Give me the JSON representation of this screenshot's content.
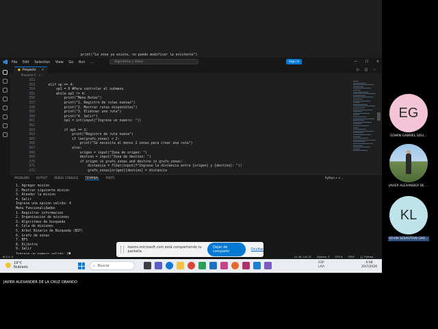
{
  "top_code": {
    "line": "print(\"La zona ya existe, no puedo modificar la existente\")"
  },
  "vscode": {
    "menu": [
      "File",
      "Edit",
      "Selection",
      "View",
      "Go",
      "Run",
      "..."
    ],
    "search_placeholder": "Algoritmos y datos",
    "sign_in": "Sign In",
    "explorer_title": "Proyecto",
    "explorer_folder": "Proyecto Y...",
    "active_tab": "Proyecto",
    "breadcrumb": "Proyecto Y... > ...",
    "code_lines": [
      {
        "n": "352",
        "t": ""
      },
      {
        "n": "353",
        "t": "    elif op == 4:"
      },
      {
        "n": "354",
        "t": "        op1 = 0 #Para controlar el submenu"
      },
      {
        "n": "355",
        "t": "        while op1 != 4:"
      },
      {
        "n": "356",
        "t": "            print(\"Menu Rutas\")"
      },
      {
        "n": "357",
        "t": "            print(\"1. Registro de rutas nuevas\")"
      },
      {
        "n": "358",
        "t": "            print(\"2. Mostrar rutas disponibles\")"
      },
      {
        "n": "359",
        "t": "            print(\"3. Eliminar una ruta\")"
      },
      {
        "n": "360",
        "t": "            print(\"4. Salir\")"
      },
      {
        "n": "361",
        "t": "            op1 = int(input(\"Ingrese un numero: \"))"
      },
      {
        "n": "362",
        "t": ""
      },
      {
        "n": "363",
        "t": "            if op1 == 1:"
      },
      {
        "n": "364",
        "t": "                print(\"Registro de ruta nueva\")"
      },
      {
        "n": "365",
        "t": "                if len(grafo_zonas) < 2:"
      },
      {
        "n": "366",
        "t": "                    print(\"Se necesita al menos 2 zonas para crear una ruta\")"
      },
      {
        "n": "367",
        "t": "                else:"
      },
      {
        "n": "368",
        "t": "                    origen = input(\"Zona de origen: \")"
      },
      {
        "n": "369",
        "t": "                    destino = input(\"Zona de destino: \")"
      },
      {
        "n": "370",
        "t": "                    if origen in grafo_zonas and destino in grafo_zonas:"
      },
      {
        "n": "371",
        "t": "                        distancia = float(input(f\"Ingrese la distancia entre {origen} y {destino}: \"))"
      },
      {
        "n": "372",
        "t": "                        grafo_zonas[origen][destino] = distancia"
      }
    ],
    "panel_tabs": [
      "PROBLEMS",
      "OUTPUT",
      "DEBUG CONSOLE",
      "TERMINAL",
      "PORTS"
    ],
    "panel_tools": "Python + v  ...",
    "terminal_lines": [
      "1. Agregar mision",
      "2. Mostrar siguiente mision",
      "3. Atender la mision",
      "4. Salir",
      "Ingrese una opcion valida: 4",
      "Menu Funcionalidades",
      "1. Registrar informacion",
      "2. Organizacion de misiones",
      "3. Algoritmos de busqueda",
      "4. Cola de misiones",
      "5. Arbol Binario de Busqueda (BST)",
      "6. Grafo de zonas",
      "7. BFS",
      "8. Dijkstra",
      "9. Salir"
    ],
    "terminal_prompt": "Ingrese un numero valido: 6",
    "status_left": "⊗ 0 ⚠ 0",
    "status_right": [
      "Ln 16, Col 31",
      "Spaces: 4",
      "UTF-8",
      "CRLF",
      "{} Python"
    ]
  },
  "share_bar": {
    "text": "teams.microsoft.com está compartiendo tu pantalla.",
    "stop_label": "Dejar de compartir",
    "hide_label": "Ocultar"
  },
  "taskbar": {
    "temp": "19°C",
    "weather": "Nublado",
    "search_label": "Buscar",
    "lang": "ESP",
    "lang2": "LAA",
    "time": "0:08",
    "date": "20/7/2026"
  },
  "presenter": "JAVIER ALEXANDER DE LA CRUZ OBANDO",
  "participants": [
    {
      "initials": "EG",
      "name": "EDWIN GABRIEL SOLI...",
      "color": "#f3c4d6"
    },
    {
      "initials": "",
      "name": "JAVIER ALEXANDER DE ...",
      "color": "#8fb7d8"
    },
    {
      "initials": "KL",
      "name": "KEVIN SEBASTIAN GAR...",
      "color": "#bfe3ea"
    }
  ]
}
